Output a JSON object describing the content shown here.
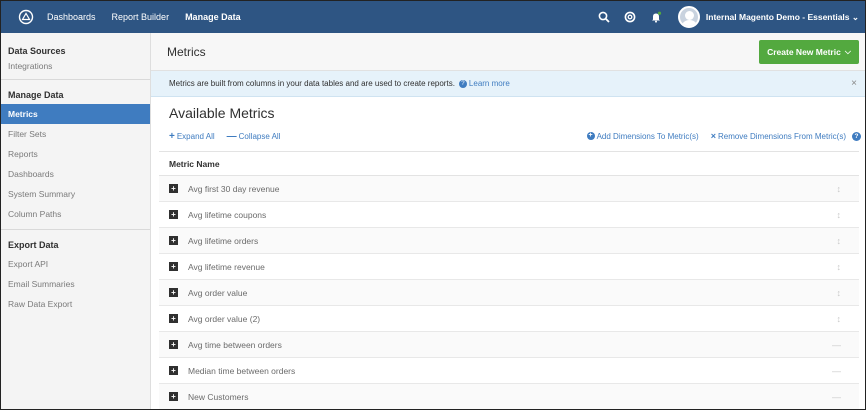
{
  "topbar": {
    "nav": [
      {
        "label": "Dashboards",
        "active": false
      },
      {
        "label": "Report Builder",
        "active": false
      },
      {
        "label": "Manage Data",
        "active": true
      }
    ],
    "user_name": "Internal Magento Demo - Essentials ⌄",
    "icons": [
      "search-icon",
      "settings-icon",
      "notifications-icon"
    ]
  },
  "sidebar": {
    "groups": [
      {
        "heading": "Data Sources",
        "items": [
          {
            "label": "Integrations",
            "active": false
          }
        ]
      },
      {
        "heading": "Manage Data",
        "items": [
          {
            "label": "Metrics",
            "active": true
          },
          {
            "label": "Filter Sets",
            "active": false
          },
          {
            "label": "Reports",
            "active": false
          },
          {
            "label": "Dashboards",
            "active": false
          },
          {
            "label": "System Summary",
            "active": false
          },
          {
            "label": "Column Paths",
            "active": false
          }
        ]
      },
      {
        "heading": "Export Data",
        "items": [
          {
            "label": "Export API",
            "active": false
          },
          {
            "label": "Email Summaries",
            "active": false
          },
          {
            "label": "Raw Data Export",
            "active": false
          }
        ]
      }
    ]
  },
  "main": {
    "page_title": "Metrics",
    "create_button": "Create New Metric",
    "info_text": "Metrics are built from columns in your data tables and are used to create reports.",
    "learn_more": "Learn more",
    "section_title": "Available Metrics",
    "expand_all": "Expand All",
    "collapse_all": "Collapse All",
    "add_dimensions": "Add Dimensions To Metric(s)",
    "remove_dimensions": "Remove Dimensions From Metric(s)",
    "column_header": "Metric Name",
    "rows": [
      "Avg first 30 day revenue",
      "Avg lifetime coupons",
      "Avg lifetime orders",
      "Avg lifetime revenue",
      "Avg order value",
      "Avg order value (2)",
      "Avg time between orders",
      "Median time between orders",
      "New Customers"
    ]
  },
  "colors": {
    "topbar": "#2e5583",
    "accent": "#3f7cc0",
    "create_button": "#53a93f",
    "info_bg": "#e6f2fa"
  }
}
